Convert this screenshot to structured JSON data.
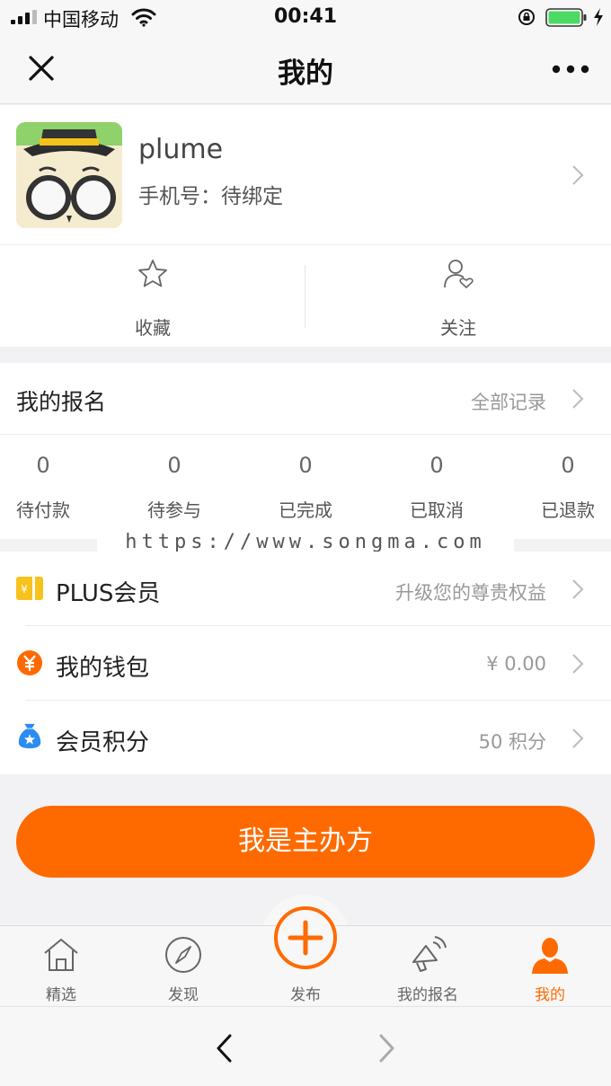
{
  "status_bar": {
    "carrier": "中国移动",
    "time": "00:41"
  },
  "navbar": {
    "title": "我的"
  },
  "profile": {
    "username": "plume",
    "phone": "手机号：待绑定"
  },
  "quick_actions": [
    {
      "label": "收藏",
      "icon": "star-icon"
    },
    {
      "label": "关注",
      "icon": "user-heart-icon"
    }
  ],
  "registration": {
    "title": "我的报名",
    "all_records": "全部记录",
    "counts": [
      {
        "value": "0",
        "label": "待付款"
      },
      {
        "value": "0",
        "label": "待参与"
      },
      {
        "value": "0",
        "label": "已完成"
      },
      {
        "value": "0",
        "label": "已取消"
      },
      {
        "value": "0",
        "label": "已退款"
      }
    ]
  },
  "watermark": "https://www.songma.com",
  "menu": [
    {
      "label": "PLUS会员",
      "value": "升级您的尊贵权益",
      "icon": "plus-card-icon"
    },
    {
      "label": "我的钱包",
      "value": "¥ 0.00",
      "icon": "yen-coin-icon"
    },
    {
      "label": "会员积分",
      "value": "50 积分",
      "icon": "money-bag-icon"
    }
  ],
  "cta": {
    "label": "我是主办方"
  },
  "tabbar": [
    {
      "label": "精选",
      "icon": "home-icon",
      "active": false
    },
    {
      "label": "发现",
      "icon": "compass-icon",
      "active": false
    },
    {
      "label": "发布",
      "icon": "plus-circle-icon",
      "active": false
    },
    {
      "label": "我的报名",
      "icon": "megaphone-icon",
      "active": false
    },
    {
      "label": "我的",
      "icon": "person-icon",
      "active": true
    }
  ],
  "colors": {
    "accent": "#ff6a00",
    "text": "#222222",
    "muted": "#999999"
  }
}
